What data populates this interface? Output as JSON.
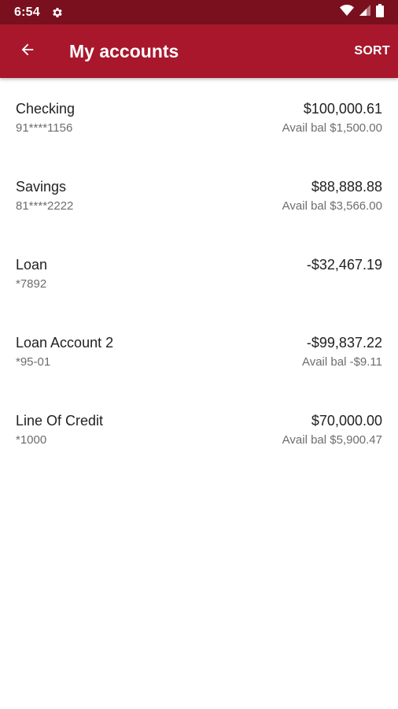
{
  "status_bar": {
    "time": "6:54",
    "icons": [
      "gear-icon",
      "wifi-icon",
      "cell-signal-icon",
      "battery-icon"
    ]
  },
  "app_bar": {
    "title": "My accounts",
    "sort_label": "SORT",
    "back_icon": "arrow-left-icon"
  },
  "colors": {
    "status_bar": "#7a101e",
    "app_bar": "#a8172b",
    "primary_text": "#222222",
    "secondary_text": "#6d6d6d"
  },
  "accounts": [
    {
      "name": "Checking",
      "number": "91****1156",
      "balance": "$100,000.61",
      "avail": "Avail bal $1,500.00"
    },
    {
      "name": "Savings",
      "number": "81****2222",
      "balance": "$88,888.88",
      "avail": "Avail bal $3,566.00"
    },
    {
      "name": "Loan",
      "number": "*7892",
      "balance": "-$32,467.19",
      "avail": ""
    },
    {
      "name": "Loan Account 2",
      "number": "*95-01",
      "balance": "-$99,837.22",
      "avail": "Avail bal -$9.11"
    },
    {
      "name": "Line Of Credit",
      "number": "*1000",
      "balance": "$70,000.00",
      "avail": "Avail bal $5,900.47"
    }
  ]
}
